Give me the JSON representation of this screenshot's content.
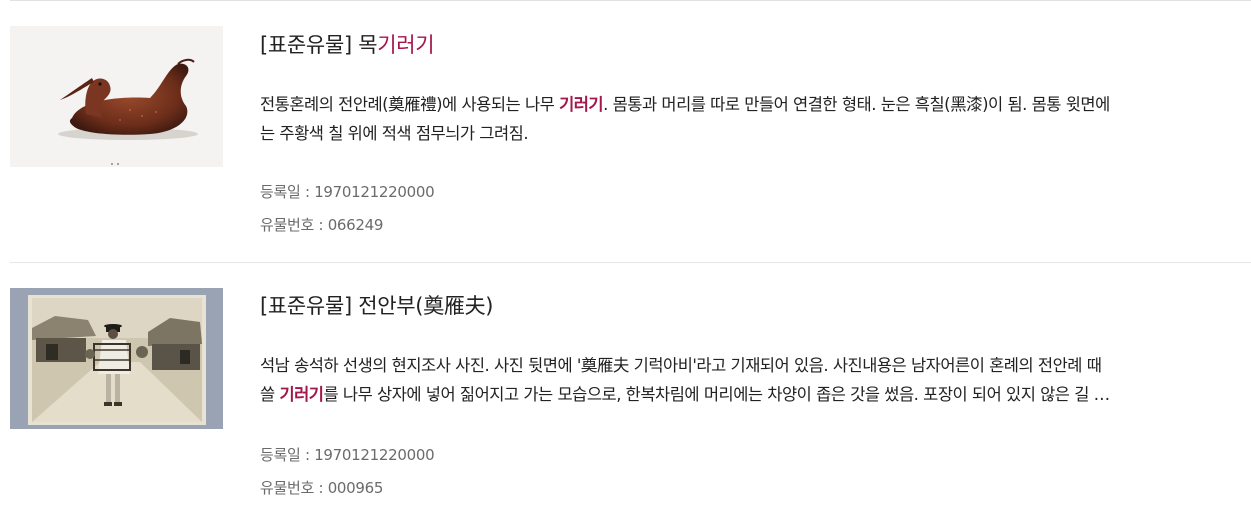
{
  "results": [
    {
      "title_prefix": "[표준유물] 목",
      "title_highlight": "기러기",
      "title_suffix": "",
      "desc_line1_a": "전통혼례의 전안례(奠雁禮)에 사용되는 나무 ",
      "desc_line1_hl": "기러기",
      "desc_line1_b": ". 몸통과 머리를 따로 만들어 연결한 형태. 눈은 흑칠(黑漆)이 됨. 몸통 윗면에",
      "desc_line2_a": "는 주황색 칠 위에 적색 점무늬가 그려짐.",
      "desc_line2_hl": "",
      "desc_line2_b": "",
      "reg_date": "등록일 : 1970121220000",
      "item_no": "유물번호 : 066249",
      "thumb_alt": "wooden-duck-photo"
    },
    {
      "title_prefix": "[표준유물] 전안부(奠雁夫)",
      "title_highlight": "",
      "title_suffix": "",
      "desc_line1_a": "석남 송석하 선생의 현지조사 사진. 사진 뒷면에 '奠雁夫 기럭아비'라고 기재되어 있음. 사진내용은 남자어른이 혼례의 전안례 때",
      "desc_line1_hl": "",
      "desc_line1_b": "",
      "desc_line2_a": "쓸 ",
      "desc_line2_hl": "기러기",
      "desc_line2_b": "를 나무 상자에 넣어 짊어지고 가는 모습으로, 한복차림에 머리에는 차양이 좁은 갓을 썼음. 포장이 되어 있지 않은 길 …",
      "reg_date": "등록일 : 1970121220000",
      "item_no": "유물번호 : 000965",
      "thumb_alt": "vintage-photo"
    }
  ],
  "colors": {
    "highlight": "#a3174a",
    "meta_text": "#6b6b6b",
    "divider": "#e6e6e6"
  }
}
